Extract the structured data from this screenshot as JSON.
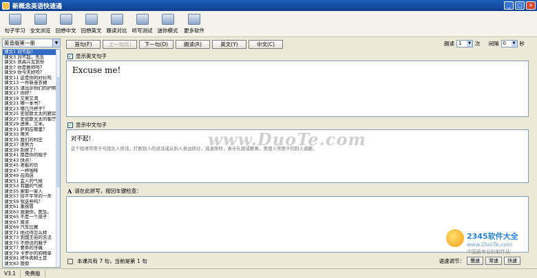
{
  "window": {
    "title": "新概念英语快速通"
  },
  "toolbar": [
    {
      "label": "句子学习",
      "icon": "sentence-icon"
    },
    {
      "label": "全文浏览",
      "icon": "book-icon"
    },
    {
      "label": "回想中文",
      "icon": "cd-icon"
    },
    {
      "label": "回想英文",
      "icon": "folder-icon"
    },
    {
      "label": "跟读对比",
      "icon": "monitor-icon"
    },
    {
      "label": "听写测试",
      "icon": "pen-icon"
    },
    {
      "label": "迷你模式",
      "icon": "globe-icon"
    },
    {
      "label": "更多软件",
      "icon": "software-icon"
    }
  ],
  "book": {
    "selected": "英音版第一册"
  },
  "lessons": [
    "课文1 对不起！",
    "课文3 对不起，先生",
    "课文5 很高兴见到你",
    "课文7 你是教师吗？",
    "课文9 你今天好吗？",
    "课文11 这是你的衬衫吗",
    "课文13 一件新连衣裙",
    "课文15 请出示你们的护照",
    "课文17 你好！",
    "课文19 又累又渴",
    "课文21 哪一本书？",
    "课文23 哪几只杯子？",
    "课文25 史密斯太太的厨房",
    "课文27 史密斯太太的客厅",
    "课文29 进来，艾米。",
    "课文31 萨莉在哪里？",
    "课文33 晴天",
    "课文35 我们的村庄",
    "课文37 很努力",
    "课文39 别摔了！",
    "课文41 那是你的帽子",
    "课文43 快点！",
    "课文45 老板的信",
    "课文47 一杯咖啡",
    "课文49 在肉店",
    "课文51 宜人的气候",
    "课文53 有趣的气候",
    "课文55 索耶一家人",
    "课文57 徐不平常的一天",
    "课文59 就这些吗？",
    "课文61 重感冒",
    "课文63 谢谢你，医生。",
    "课文65 不是一个孩子",
    "课文67 周末",
    "课文69 汽车比赛",
    "课文71 他过得怎么样",
    "课文73 到国王街的去法",
    "课文75 不舒适的鞋子",
    "课文77 要命的牙痛",
    "课文79 卡罗尔的购物单",
    "课文81 烤牛肉和土豆",
    "课文83 度假"
  ],
  "nav": {
    "buttons": [
      "首句(F)",
      "上一句(E)",
      "下一句(D)",
      "朗读(R)",
      "英文(Y)",
      "中文(C)"
    ],
    "disabled_index": 1,
    "read_label": "朗读",
    "read_value": "1",
    "times_label": "次",
    "interval_label": "间隔",
    "interval_value": "0",
    "seconds_label": "秒"
  },
  "english": {
    "show_label": "显示英文句子",
    "sentence": "Excuse me!"
  },
  "chinese": {
    "show_label": "显示中文句子",
    "sentence": "对不起！",
    "note": "这个短语常用于与陌生人搭话，打断别人的说话或从别人身边挤过，或退席时，表示礼貌或歉意。美国人常用于向别人道歉。"
  },
  "typing": {
    "prompt": "请在此拼写，按回车键检查：",
    "prompt_icon": "A"
  },
  "status": {
    "progress": "本课共有 7 句，当前是第 1 句",
    "speed_label": "语速调节：",
    "buttons": [
      "慢速",
      "常速",
      "快速"
    ]
  },
  "statusbar": {
    "version": "V3.1",
    "edition": "免费版"
  },
  "watermarks": {
    "center": "www.DuoTe.com",
    "brand": "2345软件大全",
    "url": "www.DuoTe.com",
    "sub": "中国最专业的软件站"
  }
}
